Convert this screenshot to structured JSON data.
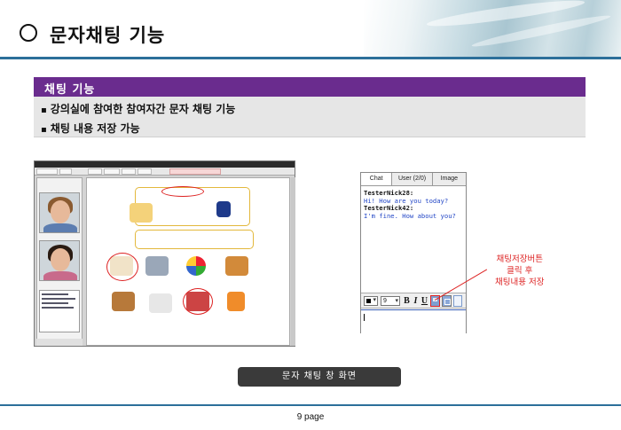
{
  "header": {
    "title": "문자채팅 기능"
  },
  "section": {
    "heading": "채팅 기능",
    "bullets": [
      "강의실에 참여한 참여자간 문자 채팅 기능",
      "채팅 내용 저장 가능"
    ]
  },
  "chat_window": {
    "tabs": [
      "Chat",
      "User (2/0)",
      "Image"
    ],
    "log": [
      {
        "nick": "TesterNick28:",
        "message": "Hi! How are you today?"
      },
      {
        "nick": "TesterNick42:",
        "message": "I'm fine. How about you?"
      }
    ],
    "toolbar": {
      "font_size": "9",
      "bold": "B",
      "italic": "I",
      "underline": "U"
    }
  },
  "callout": {
    "lines": [
      "채팅저장버튼",
      "클릭 후",
      "채팅내용 저장"
    ]
  },
  "caption": "문자 채팅 창 화면",
  "footer": {
    "page": "9 page"
  },
  "colors": {
    "accent_purple": "#6a2c8e",
    "rule_blue": "#2c6f9a",
    "highlight_red": "#dd2222",
    "chat_message_blue": "#2347c6"
  },
  "icons": {
    "title_marker": "circle-icon",
    "color_picker": "color-picker-icon",
    "save_chat": "save-chat-icon",
    "disk": "disk-icon",
    "document": "document-icon"
  }
}
